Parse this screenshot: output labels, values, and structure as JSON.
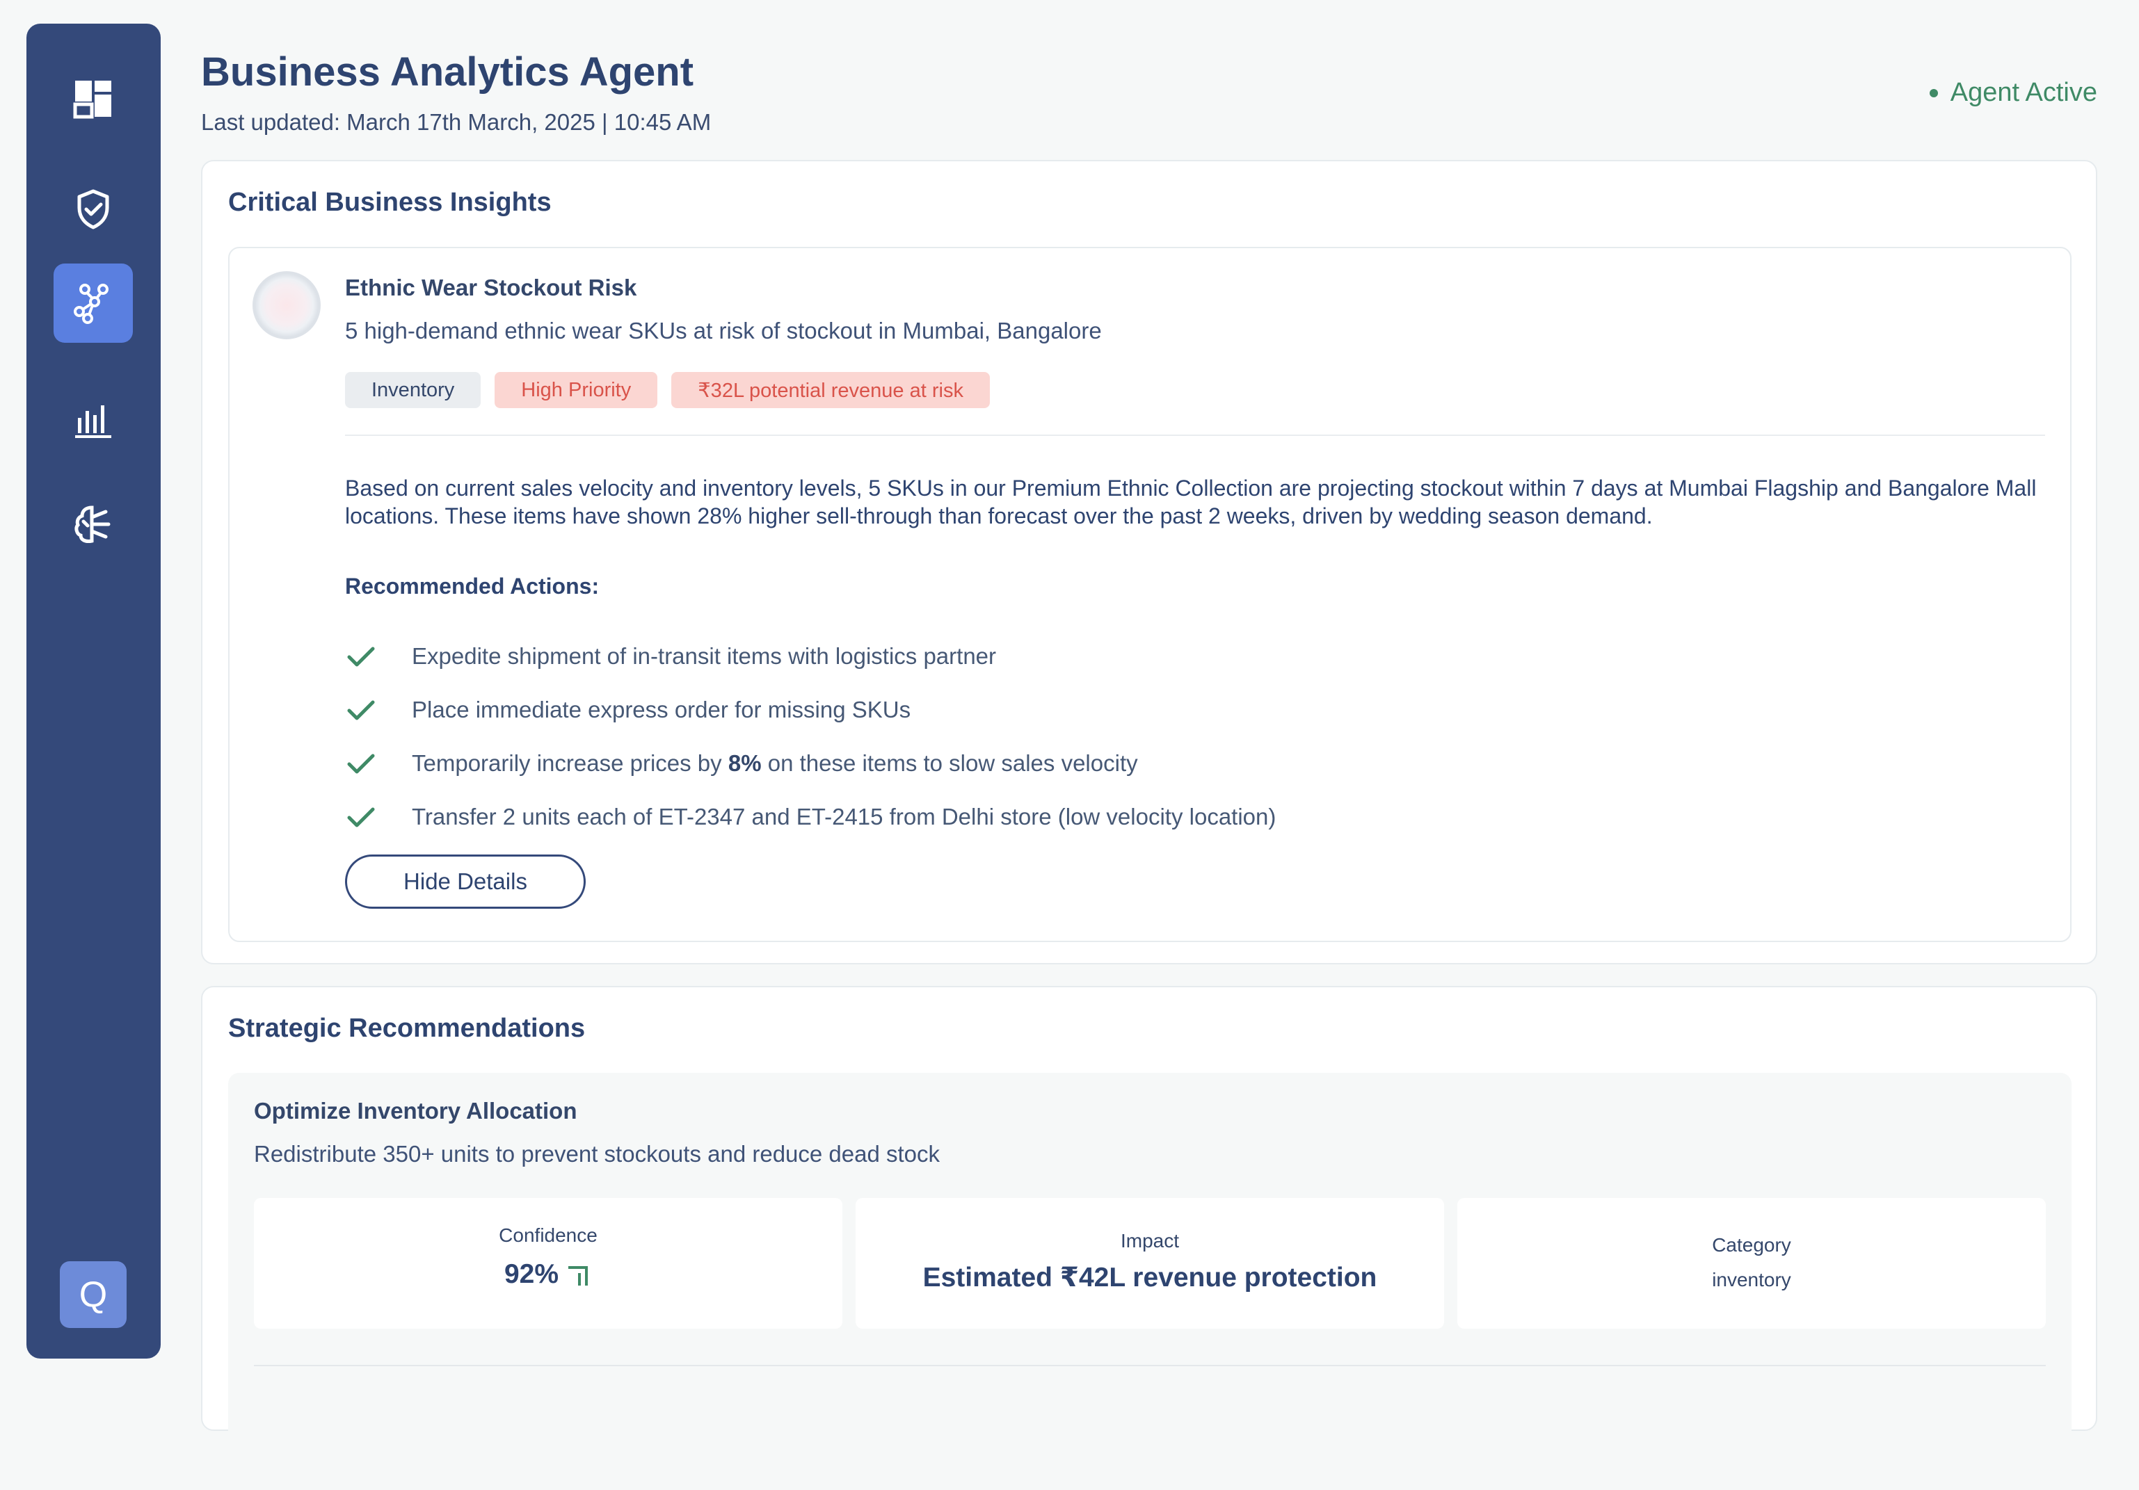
{
  "sidebar": {
    "items": [
      {
        "name": "dashboard",
        "icon": "dashboard-icon",
        "active": false
      },
      {
        "name": "security",
        "icon": "shield-check-icon",
        "active": false
      },
      {
        "name": "network",
        "icon": "network-nodes-icon",
        "active": true
      },
      {
        "name": "analytics",
        "icon": "bar-chart-icon",
        "active": false
      },
      {
        "name": "ai",
        "icon": "brain-circuit-icon",
        "active": false
      }
    ],
    "user_initial": "Q"
  },
  "header": {
    "title": "Business Analytics Agent",
    "last_updated": "Last updated: March 17th March, 2025 | 10:45 AM",
    "status": "Agent Active"
  },
  "insights": {
    "section_title": "Critical Business Insights",
    "card": {
      "title": "Ethnic Wear Stockout Risk",
      "subtitle": "5 high-demand ethnic wear SKUs at risk of stockout in Mumbai, Bangalore",
      "tags": {
        "category": "Inventory",
        "priority": "High Priority",
        "revenue": "₹32L potential revenue at risk"
      },
      "description": "Based on current sales velocity and inventory levels, 5 SKUs in our Premium Ethnic Collection are projecting stockout within 7 days at Mumbai Flagship and Bangalore Mall locations. These items have shown 28% higher sell-through than forecast over the past 2 weeks, driven by wedding season demand.",
      "recommended_title": "Recommended Actions:",
      "actions": {
        "a1": "Expedite shipment of in-transit items with logistics partner",
        "a2": "Place immediate express order for missing SKUs",
        "a3_prefix": "Temporarily increase prices by ",
        "a3_bold": "8%",
        "a3_suffix": " on these items to slow sales velocity",
        "a4": "Transfer 2 units each of ET-2347 and ET-2415 from Delhi store (low velocity location)"
      },
      "hide_button": "Hide Details"
    }
  },
  "strategic": {
    "section_title": "Strategic Recommendations",
    "card": {
      "title": "Optimize Inventory Allocation",
      "subtitle": "Redistribute 350+ units to prevent stockouts and reduce dead stock",
      "confidence_label": "Confidence",
      "confidence_value": "92%",
      "impact_label": "Impact",
      "impact_value": "Estimated ₹42L revenue protection",
      "category_label": "Category",
      "category_value": "inventory"
    }
  },
  "colors": {
    "sidebar": "#34497a",
    "active_nav": "#5a7fe0",
    "status_green": "#3f8a66",
    "danger_bg": "#fbd6d2",
    "danger_text": "#d9534a"
  }
}
